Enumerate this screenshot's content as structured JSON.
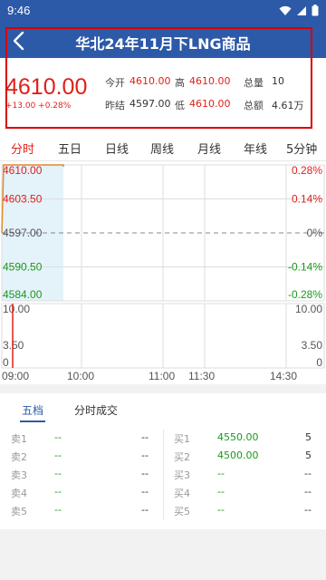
{
  "status_bar": {
    "time": "9:46"
  },
  "header": {
    "title": "华北24年11月下LNG商品"
  },
  "quote": {
    "price": "4610.00",
    "change": "+13.00 +0.28%",
    "open_label": "今开",
    "open": "4610.00",
    "high_label": "高",
    "high": "4610.00",
    "volume_label": "总量",
    "volume": "10",
    "prev_close_label": "昨结",
    "prev_close": "4597.00",
    "low_label": "低",
    "low": "4610.00",
    "amount_label": "总额",
    "amount": "4.61万"
  },
  "tabs": [
    "分时",
    "五日",
    "日线",
    "周线",
    "月线",
    "年线",
    "5分钟"
  ],
  "active_tab": 0,
  "chart": {
    "price_labels_left": [
      "4610.00",
      "4603.50",
      "4597.00",
      "4590.50",
      "4584.00"
    ],
    "pct_labels_right": [
      "0.28%",
      "0.14%",
      "0%",
      "-0.14%",
      "-0.28%"
    ],
    "volume_labels_left": [
      "10.00",
      "3.50",
      "0"
    ],
    "volume_labels_right": [
      "10.00",
      "3.50",
      "0"
    ],
    "time_labels": [
      "09:00",
      "10:00",
      "11:00",
      "11:30",
      "14:30"
    ],
    "colors": {
      "up": "#e0201a",
      "down": "#1a9a1a",
      "line": "#e08a2a",
      "grid": "#dcdcdc",
      "highlight": "#e4f2fa"
    }
  },
  "chart_data": {
    "type": "line",
    "title": "",
    "x": [
      "09:00"
    ],
    "series": [
      {
        "values": [
          4610.0
        ]
      }
    ],
    "ylim": [
      4584.0,
      4610.0
    ],
    "reference_line": 4597.0,
    "volume": {
      "x": [
        "09:00"
      ],
      "values": [
        10
      ],
      "ylim": [
        0,
        10
      ]
    }
  },
  "lower_tabs": [
    "五档",
    "分时成交"
  ],
  "orderbook": {
    "sell": [
      {
        "label": "卖1",
        "price": "--",
        "vol": "--"
      },
      {
        "label": "卖2",
        "price": "--",
        "vol": "--"
      },
      {
        "label": "卖3",
        "price": "--",
        "vol": "--"
      },
      {
        "label": "卖4",
        "price": "--",
        "vol": "--"
      },
      {
        "label": "卖5",
        "price": "--",
        "vol": "--"
      }
    ],
    "buy": [
      {
        "label": "买1",
        "price": "4550.00",
        "vol": "5"
      },
      {
        "label": "买2",
        "price": "4500.00",
        "vol": "5"
      },
      {
        "label": "买3",
        "price": "--",
        "vol": "--"
      },
      {
        "label": "买4",
        "price": "--",
        "vol": "--"
      },
      {
        "label": "买5",
        "price": "--",
        "vol": "--"
      }
    ]
  }
}
